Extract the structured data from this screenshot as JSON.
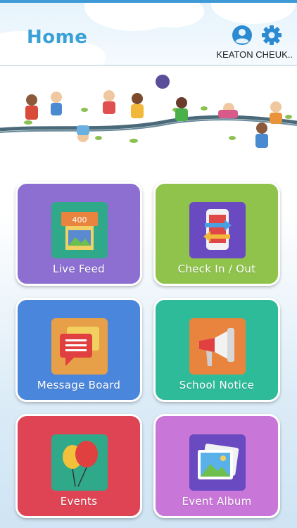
{
  "header": {
    "title": "Home",
    "user_name": "KEATON CHEUK..",
    "profile_icon": "account-circle-icon",
    "settings_icon": "gear-icon"
  },
  "banner": {
    "image": "kids-on-tree-branch-illustration"
  },
  "tiles": [
    {
      "label": "Live Feed",
      "icon": "film-counter-icon",
      "counter": "400",
      "color": "#8c6fd1"
    },
    {
      "label": "Check In / Out",
      "icon": "phone-transfer-icon",
      "color": "#8fc34c"
    },
    {
      "label": "Message Board",
      "icon": "chat-bubbles-icon",
      "color": "#4a86dc"
    },
    {
      "label": "School Notice",
      "icon": "megaphone-icon",
      "color": "#2dbb9a"
    },
    {
      "label": "Events",
      "icon": "balloons-icon",
      "color": "#de4454"
    },
    {
      "label": "Event Album",
      "icon": "photo-album-icon",
      "color": "#c876d8"
    }
  ]
}
